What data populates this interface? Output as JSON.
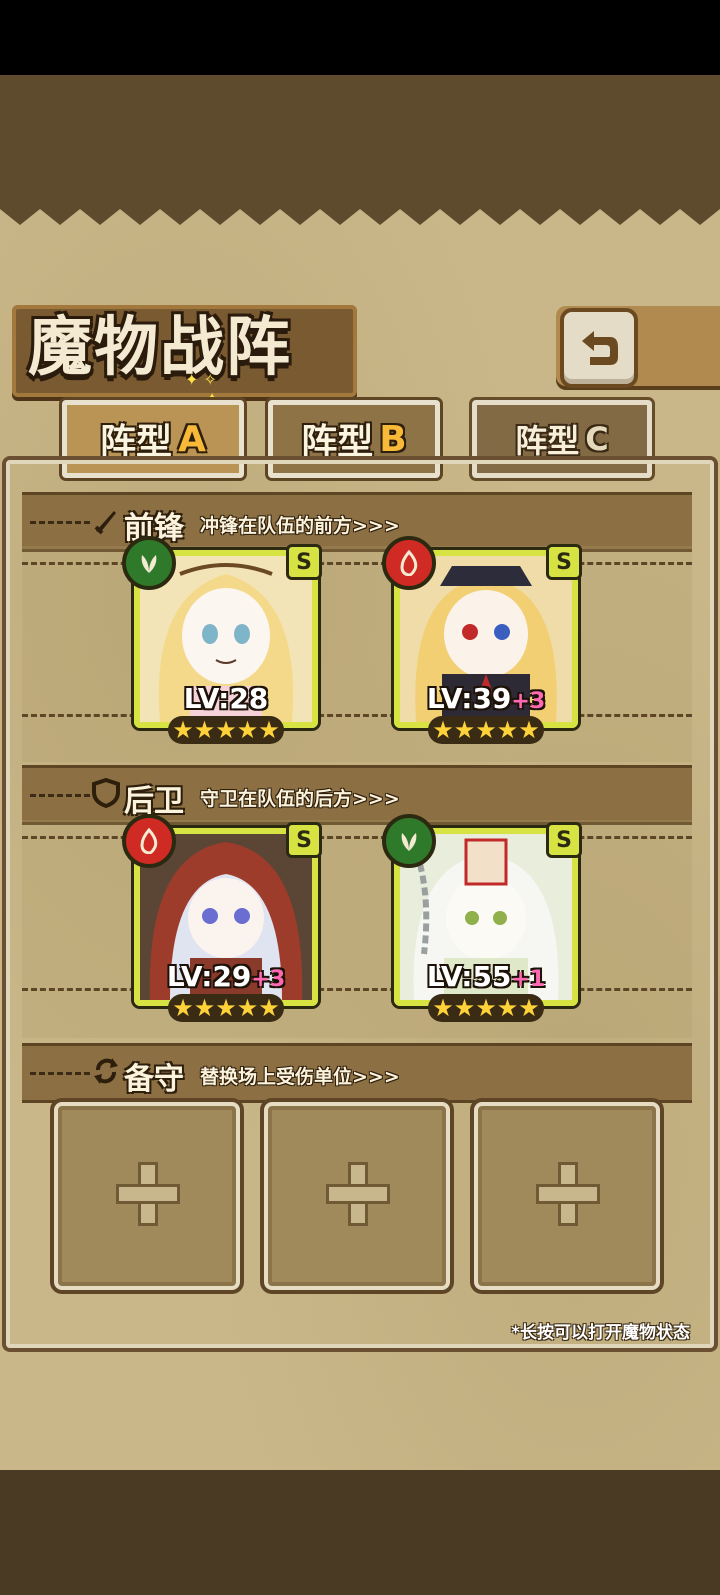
{
  "title": "魔物战阵",
  "tabs": [
    {
      "label": "阵型",
      "letter": "A"
    },
    {
      "label": "阵型",
      "letter": "B"
    },
    {
      "label": "阵型",
      "letter": "C"
    }
  ],
  "sections": {
    "front": {
      "label": "前锋",
      "desc": "冲锋在队伍的前方>>>"
    },
    "rear": {
      "label": "后卫",
      "desc": "守卫在队伍的后方>>>"
    },
    "reserve": {
      "label": "备守",
      "desc": "替换场上受伤单位>>>"
    }
  },
  "cards": [
    {
      "element": "grass",
      "rank": "S",
      "level": "LV:28",
      "plus": "",
      "stars": "★★★★★"
    },
    {
      "element": "fire",
      "rank": "S",
      "level": "LV:39",
      "plus": "+3",
      "stars": "★★★★★"
    },
    {
      "element": "fire",
      "rank": "S",
      "level": "LV:29",
      "plus": "+3",
      "stars": "★★★★★"
    },
    {
      "element": "grass",
      "rank": "S",
      "level": "LV:55",
      "plus": "+1",
      "stars": "★★★★★"
    }
  ],
  "hint": "*长按可以打开魔物状态",
  "colors": {
    "card_border": "#d7e342",
    "grass": "#2f7a2a",
    "fire": "#cf2a23",
    "panel": "#c9b789"
  }
}
